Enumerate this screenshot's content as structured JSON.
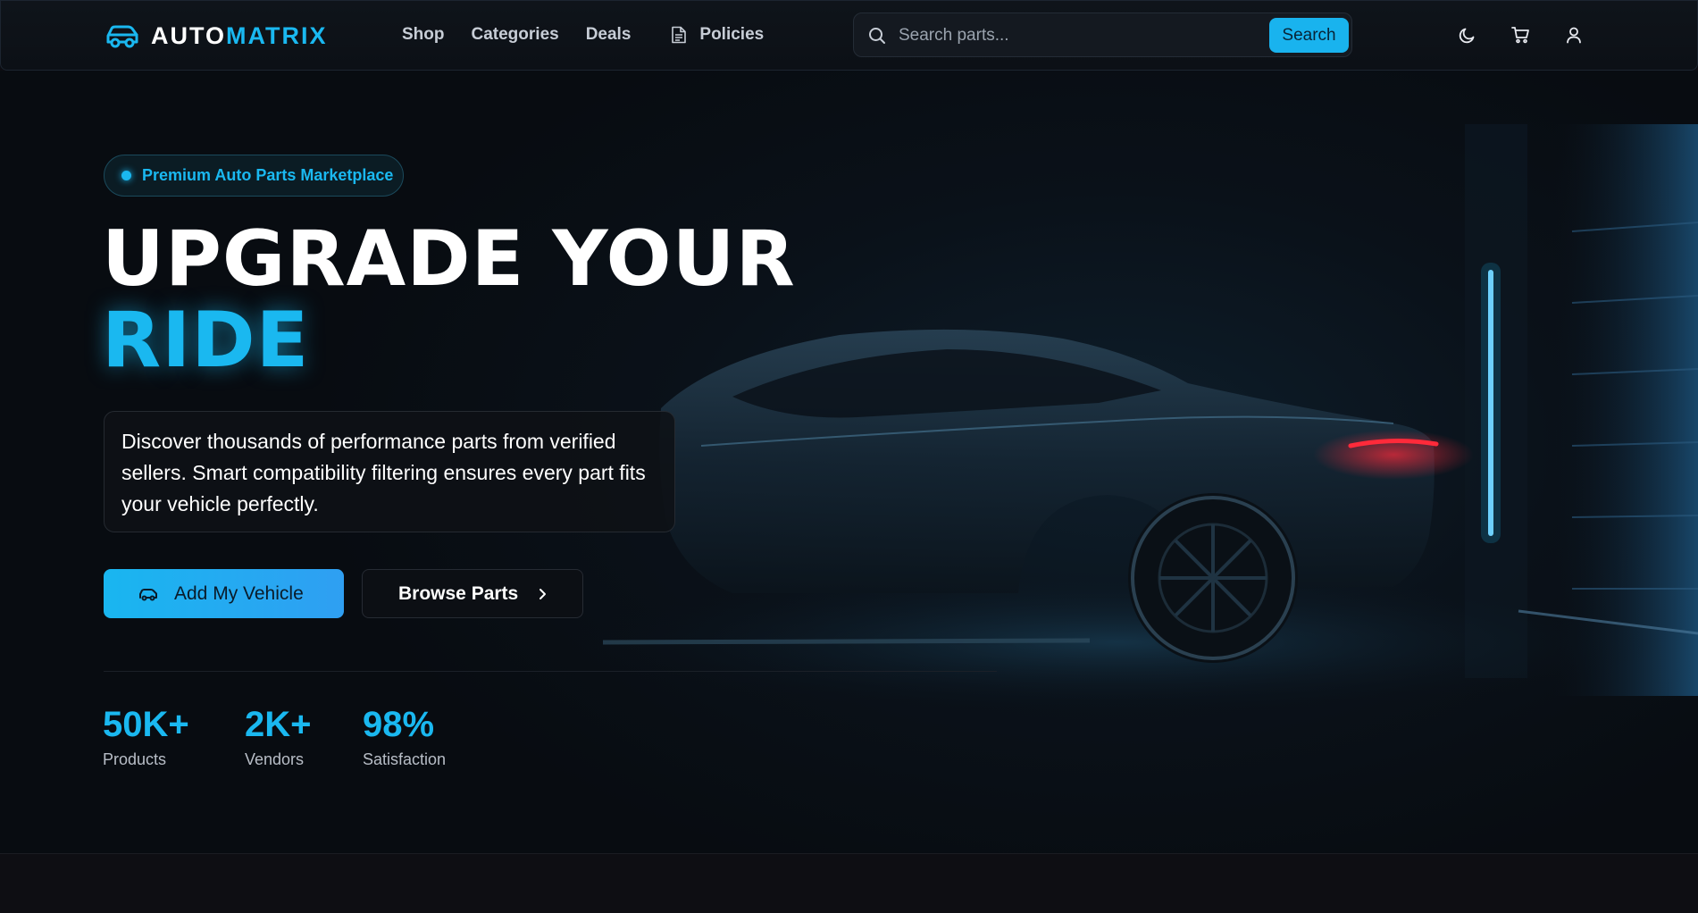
{
  "brand": {
    "name_part1": "AUTO",
    "name_part2": "MATRIX"
  },
  "nav": {
    "shop": "Shop",
    "categories": "Categories",
    "deals": "Deals",
    "policies": "Policies"
  },
  "search": {
    "placeholder": "Search parts...",
    "button": "Search"
  },
  "hero": {
    "badge": "Premium Auto Parts Marketplace",
    "title_line1": "UPGRADE YOUR",
    "title_line2": "RIDE",
    "description": "Discover thousands of performance parts from verified sellers. Smart compatibility filtering ensures every part fits your vehicle perfectly.",
    "primary_button": "Add My Vehicle",
    "secondary_button": "Browse Parts"
  },
  "stats": [
    {
      "value": "50K+",
      "label": "Products"
    },
    {
      "value": "2K+",
      "label": "Vendors"
    },
    {
      "value": "98%",
      "label": "Satisfaction"
    }
  ],
  "colors": {
    "accent": "#1ab8f0",
    "background": "#0d0d12",
    "taillight": "#ff2a3a"
  },
  "icons": [
    "car-icon",
    "document-icon",
    "search-icon",
    "moon-icon",
    "cart-icon",
    "user-icon",
    "chevron-right-icon"
  ]
}
